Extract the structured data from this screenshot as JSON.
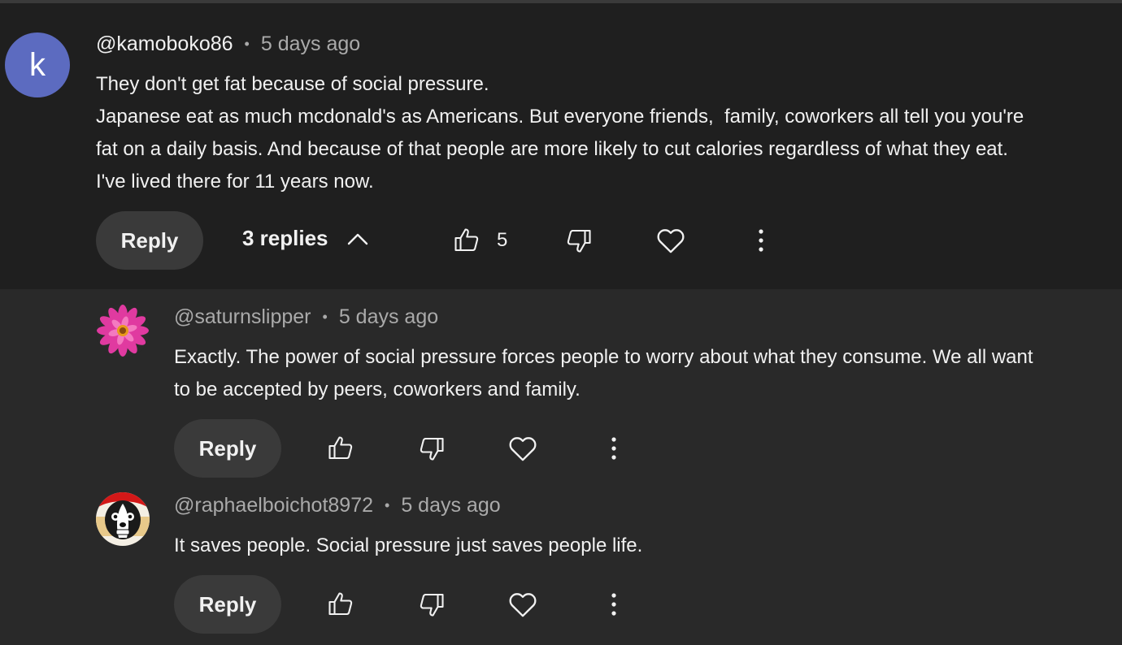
{
  "comment": {
    "avatar_letter": "k",
    "handle": "@kamoboko86",
    "separator": "•",
    "time": "5 days ago",
    "text": "They don't get fat because of social pressure.\nJapanese eat as much mcdonald's as Americans. But everyone friends,  family, coworkers all tell you you're\nfat on a daily basis. And because of that people are more likely to cut calories regardless of what they eat.\nI've lived there for 11 years now.",
    "reply_label": "Reply",
    "replies_label": "3 replies",
    "like_count": "5"
  },
  "replies": [
    {
      "handle": "@saturnslipper",
      "separator": "•",
      "time": "5 days ago",
      "text": "Exactly. The power of social pressure forces people to worry about what they consume. We all want\nto be accepted by peers, coworkers and family.",
      "reply_label": "Reply",
      "avatar": "pink-flower-avatar"
    },
    {
      "handle": "@raphaelboichot8972",
      "separator": "•",
      "time": "5 days ago",
      "text": "It saves people. Social pressure just saves people life.",
      "reply_label": "Reply",
      "avatar": "cartoon-dog-avatar"
    }
  ],
  "colors": {
    "background": "#212121",
    "avatar": "#5c6bc0",
    "button": "#3a3a3a",
    "secondary_text": "#aaaaaa"
  }
}
